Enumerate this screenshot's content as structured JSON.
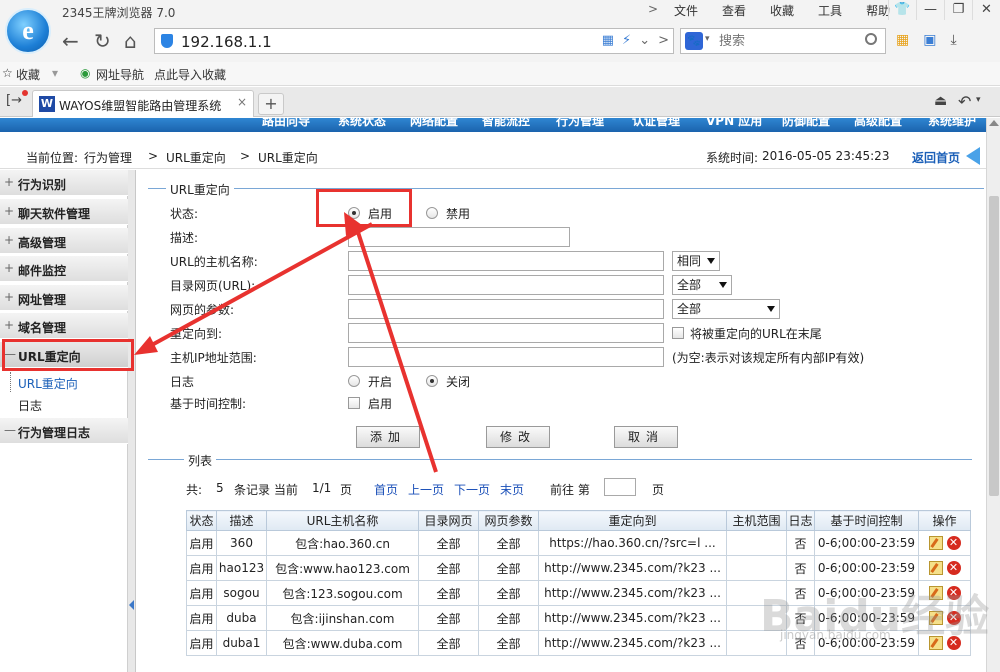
{
  "browser": {
    "title": "2345王牌浏览器 7.0",
    "menu": [
      "文件",
      "查看",
      "收藏",
      "工具",
      "帮助"
    ],
    "address": "192.168.1.1",
    "search_placeholder": "搜索",
    "bookmarks": [
      "收藏",
      "网址导航",
      "点此导入收藏"
    ],
    "tab_title": "WAYOS维盟智能路由管理系统",
    "tab_close": "×",
    "new_tab": "+"
  },
  "router": {
    "top_nav": [
      "路由向导",
      "系统状态",
      "网络配置",
      "智能流控",
      "行为管理",
      "认证管理",
      "VPN 应用",
      "防御配置",
      "高级配置",
      "系统维护"
    ],
    "breadcrumb": {
      "prefix": "当前位置:",
      "path": [
        "行为管理",
        "URL重定向",
        "URL重定向"
      ],
      "sep": ">",
      "system_time_label": "系统时间:",
      "system_time": "2016-05-05 23:45:23",
      "home_link": "返回首页"
    },
    "sidebar": {
      "items": [
        {
          "sign": "+",
          "label": "行为识别"
        },
        {
          "sign": "+",
          "label": "聊天软件管理"
        },
        {
          "sign": "+",
          "label": "高级管理"
        },
        {
          "sign": "+",
          "label": "邮件监控"
        },
        {
          "sign": "+",
          "label": "网址管理"
        },
        {
          "sign": "+",
          "label": "域名管理"
        },
        {
          "sign": "—",
          "label": "URL重定向"
        },
        {
          "sign": "—",
          "label": "行为管理日志"
        }
      ],
      "subitems": [
        "URL重定向",
        "日志"
      ]
    },
    "form": {
      "legend": "URL重定向",
      "status_label": "状态:",
      "status_on": "启用",
      "status_off": "禁用",
      "desc_label": "描述:",
      "host_label": "URL的主机名称:",
      "host_match": "相同",
      "target_label": "目录网页(URL):",
      "target_match": "全部",
      "param_label": "网页的参数:",
      "param_match": "全部",
      "redirect_label": "重定向到:",
      "redirect_append": "将被重定向的URL在末尾",
      "ip_label": "主机IP地址范围:",
      "ip_hint": "(为空:表示对该规定所有内部IP有效)",
      "log_label": "日志",
      "log_on": "开启",
      "log_off": "关闭",
      "time_label": "基于时间控制:",
      "time_enable": "启用",
      "btn_add": "添加",
      "btn_modify": "修改",
      "btn_cancel": "取消"
    },
    "list": {
      "legend": "列表",
      "total_prefix": "共:",
      "total": "5",
      "total_suffix": "条记录 当前",
      "page": "1/1",
      "page_suffix": "页",
      "first": "首页",
      "prev": "上一页",
      "next": "下一页",
      "last": "末页",
      "goto_prefix": "前往 第",
      "goto_suffix": "页",
      "headers": [
        "状态",
        "描述",
        "URL主机名称",
        "目录网页",
        "网页参数",
        "重定向到",
        "主机范围",
        "日志",
        "基于时间控制",
        "操作"
      ],
      "rows": [
        [
          "启用",
          "360",
          "包含:hao.360.cn",
          "全部",
          "全部",
          "https://hao.360.cn/?src=l ...",
          "",
          "否",
          "0-6;00:00-23:59"
        ],
        [
          "启用",
          "hao123",
          "包含:www.hao123.com",
          "全部",
          "全部",
          "http://www.2345.com/?k23 ...",
          "",
          "否",
          "0-6;00:00-23:59"
        ],
        [
          "启用",
          "sogou",
          "包含:123.sogou.com",
          "全部",
          "全部",
          "http://www.2345.com/?k23 ...",
          "",
          "否",
          "0-6;00:00-23:59"
        ],
        [
          "启用",
          "duba",
          "包含:ijinshan.com",
          "全部",
          "全部",
          "http://www.2345.com/?k23 ...",
          "",
          "否",
          "0-6;00:00-23:59"
        ],
        [
          "启用",
          "duba1",
          "包含:www.duba.com",
          "全部",
          "全部",
          "http://www.2345.com/?k23 ...",
          "",
          "否",
          "0-6;00:00-23:59"
        ]
      ]
    }
  },
  "watermark": "Baidu经验",
  "watermark_sub": "jingyan.baidu.com",
  "colors": {
    "annotation_red": "#e8322f",
    "nav_blue": "#1b63ad",
    "link_blue": "#1a4fb8"
  }
}
